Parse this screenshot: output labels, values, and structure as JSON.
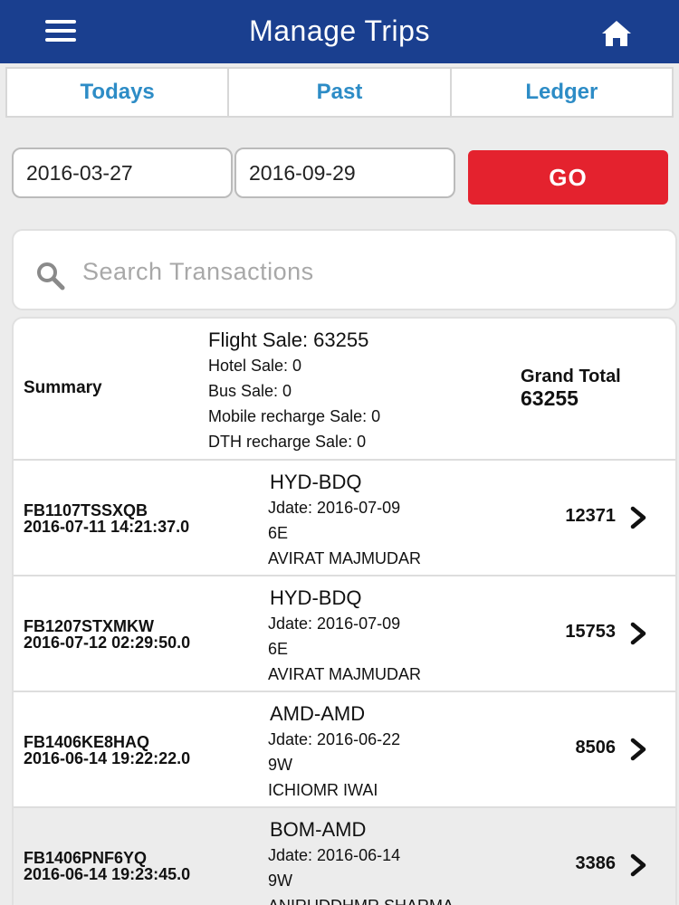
{
  "header": {
    "title": "Manage Trips",
    "icons": {
      "menu": "hamburger-menu-icon",
      "home": "home-icon"
    },
    "colors": {
      "background": "#1a3f8f"
    }
  },
  "tabs": [
    {
      "label": "Todays"
    },
    {
      "label": "Past"
    },
    {
      "label": "Ledger"
    }
  ],
  "filters": {
    "from_date": "2016-03-27",
    "to_date": "2016-09-29",
    "go_label": "GO",
    "go_color": "#e4222e"
  },
  "search": {
    "placeholder": "Search Transactions",
    "icon": "search-icon"
  },
  "summary": {
    "label": "Summary",
    "flight_sale": "Flight Sale: 63255",
    "hotel_sale": "Hotel Sale: 0",
    "bus_sale": "Bus Sale: 0",
    "mobile_sale": "Mobile recharge Sale: 0",
    "dth_sale": "DTH recharge Sale: 0",
    "grand_total_label": "Grand Total",
    "grand_total_value": "63255"
  },
  "transactions": [
    {
      "ref": "FB1107TSSXQB",
      "datetime": "2016-07-11 14:21:37.0",
      "route": "HYD-BDQ",
      "jdate": "Jdate: 2016-07-09",
      "airline": "6E",
      "passenger": "AVIRAT MAJMUDAR",
      "amount": "12371"
    },
    {
      "ref": "FB1207STXMKW",
      "datetime": "2016-07-12 02:29:50.0",
      "route": "HYD-BDQ",
      "jdate": "Jdate: 2016-07-09",
      "airline": "6E",
      "passenger": "AVIRAT MAJMUDAR",
      "amount": "15753"
    },
    {
      "ref": "FB1406KE8HAQ",
      "datetime": "2016-06-14 19:22:22.0",
      "route": "AMD-AMD",
      "jdate": "Jdate: 2016-06-22",
      "airline": "9W",
      "passenger": "ICHIOMR IWAI",
      "amount": "8506"
    },
    {
      "ref": "FB1406PNF6YQ",
      "datetime": "2016-06-14 19:23:45.0",
      "route": "BOM-AMD",
      "jdate": "Jdate: 2016-06-14",
      "airline": "9W",
      "passenger": "ANIRUDDHMR SHARMA",
      "amount": "3386"
    }
  ]
}
